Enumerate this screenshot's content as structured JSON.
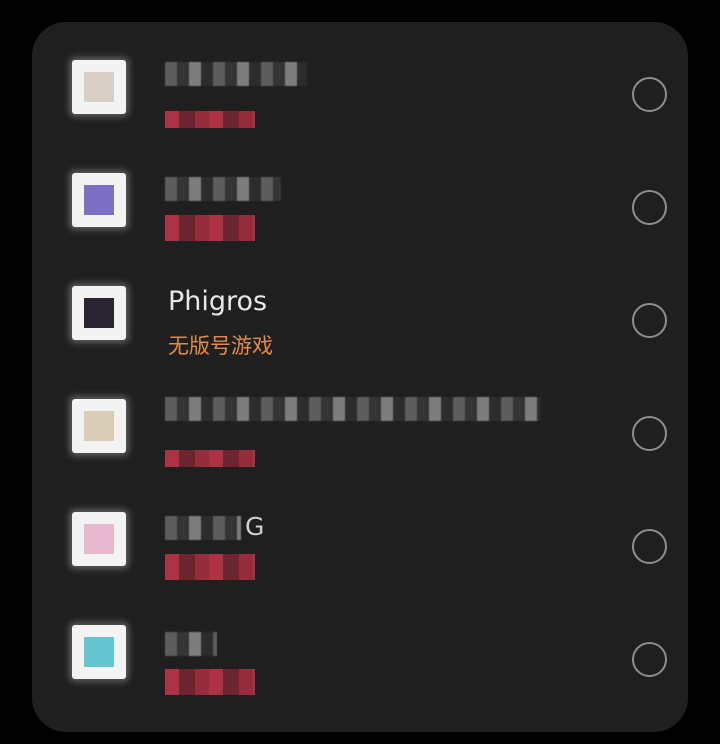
{
  "apps": [
    {
      "name": "",
      "tag": "",
      "icon": "anime-avatar-icon",
      "color": "#c9c2bb",
      "redacted": true
    },
    {
      "name": "",
      "tag": "",
      "icon": "purple-app-icon",
      "color": "#7d6fc4",
      "redacted": true
    },
    {
      "name": "Phigros",
      "tag": "无版号游戏",
      "icon": "phigros-icon",
      "color": "#2a2530",
      "redacted": false
    },
    {
      "name": "",
      "tag": "",
      "icon": "beige-app-icon",
      "color": "#d9cdb6",
      "redacted": true
    },
    {
      "name": "G",
      "tag": "",
      "icon": "pink-app-icon",
      "color": "#e7b9cf",
      "redacted": true
    },
    {
      "name": "",
      "tag": "",
      "icon": "cyan-app-icon",
      "color": "#64c4cf",
      "redacted": true
    }
  ],
  "accent_color": "#e3894a"
}
